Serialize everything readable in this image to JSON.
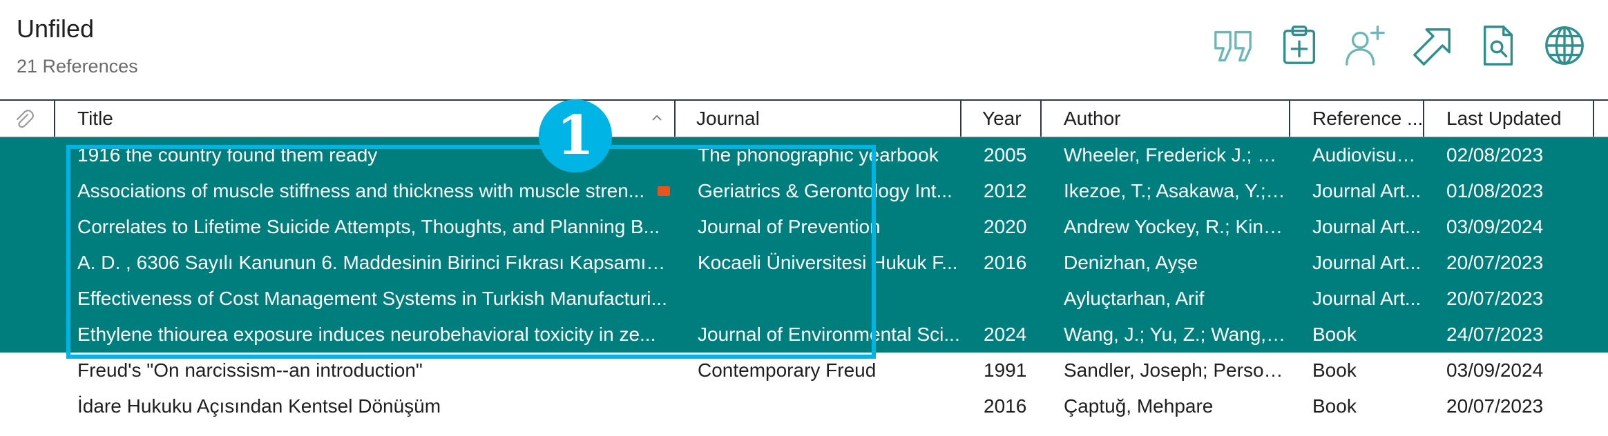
{
  "header": {
    "title": "Unfiled",
    "count": "21 References"
  },
  "toolbar": {
    "icons": [
      "quote-icon",
      "clipboard-add-icon",
      "add-person-icon",
      "share-arrow-icon",
      "find-pdf-icon",
      "web-globe-icon"
    ],
    "accent": "#2f8f8f"
  },
  "columns": {
    "title": "Title",
    "journal": "Journal",
    "year": "Year",
    "author": "Author",
    "reference_type": "Reference ...",
    "last_updated": "Last Updated"
  },
  "rows": [
    {
      "title": "1916 the country found them ready",
      "journal": "The phonographic yearbook",
      "year": "2005",
      "author": "Wheeler, Frederick J.; M...",
      "type": "Audiovisua...",
      "updated": "02/08/2023"
    },
    {
      "title": "Associations of muscle stiffness and thickness with muscle stren...",
      "journal": "Geriatrics & Gerontology Int...",
      "year": "2012",
      "author": "Ikezoe, T.; Asakawa, Y.; F...",
      "type": "Journal Art...",
      "updated": "01/08/2023"
    },
    {
      "title": "Correlates to Lifetime Suicide Attempts, Thoughts, and Planning B...",
      "journal": "Journal of Prevention",
      "year": "2020",
      "author": "Andrew Yockey, R.; King,...",
      "type": "Journal Art...",
      "updated": "03/09/2024"
    },
    {
      "title": "A. D. , 6306 Sayılı Kanunun 6. Maddesinin Birinci Fıkrası Kapsamın...",
      "journal": "Kocaeli Üniversitesi Hukuk F...",
      "year": "2016",
      "author": "Denizhan, Ayşe",
      "type": "Journal Art...",
      "updated": "20/07/2023"
    },
    {
      "title": "Effectiveness of Cost Management Systems in Turkish Manufacturi...",
      "journal": "",
      "year": "",
      "author": "Ayluçtarhan, Arif",
      "type": "Journal Art...",
      "updated": "20/07/2023"
    },
    {
      "title": "Ethylene thiourea exposure induces neurobehavioral toxicity in ze...",
      "journal": "Journal of Environmental Sci...",
      "year": "2024",
      "author": "Wang, J.; Yu, Z.; Wang, Y...",
      "type": "Book",
      "updated": "24/07/2023"
    },
    {
      "title": "Freud's \"On narcissism--an introduction\"",
      "journal": "Contemporary Freud",
      "year": "1991",
      "author": "Sandler, Joseph; Person,...",
      "type": "Book",
      "updated": "03/09/2024"
    },
    {
      "title": "İdare Hukuku Açısından Kentsel Dönüşüm",
      "journal": "",
      "year": "2016",
      "author": "Çaptuğ, Mehpare",
      "type": "Book",
      "updated": "20/07/2023"
    }
  ],
  "annotation": {
    "callout_number": "1",
    "color": "#00b5e6"
  },
  "selection_color": "#007e7e",
  "flag_color": "#e8541e"
}
